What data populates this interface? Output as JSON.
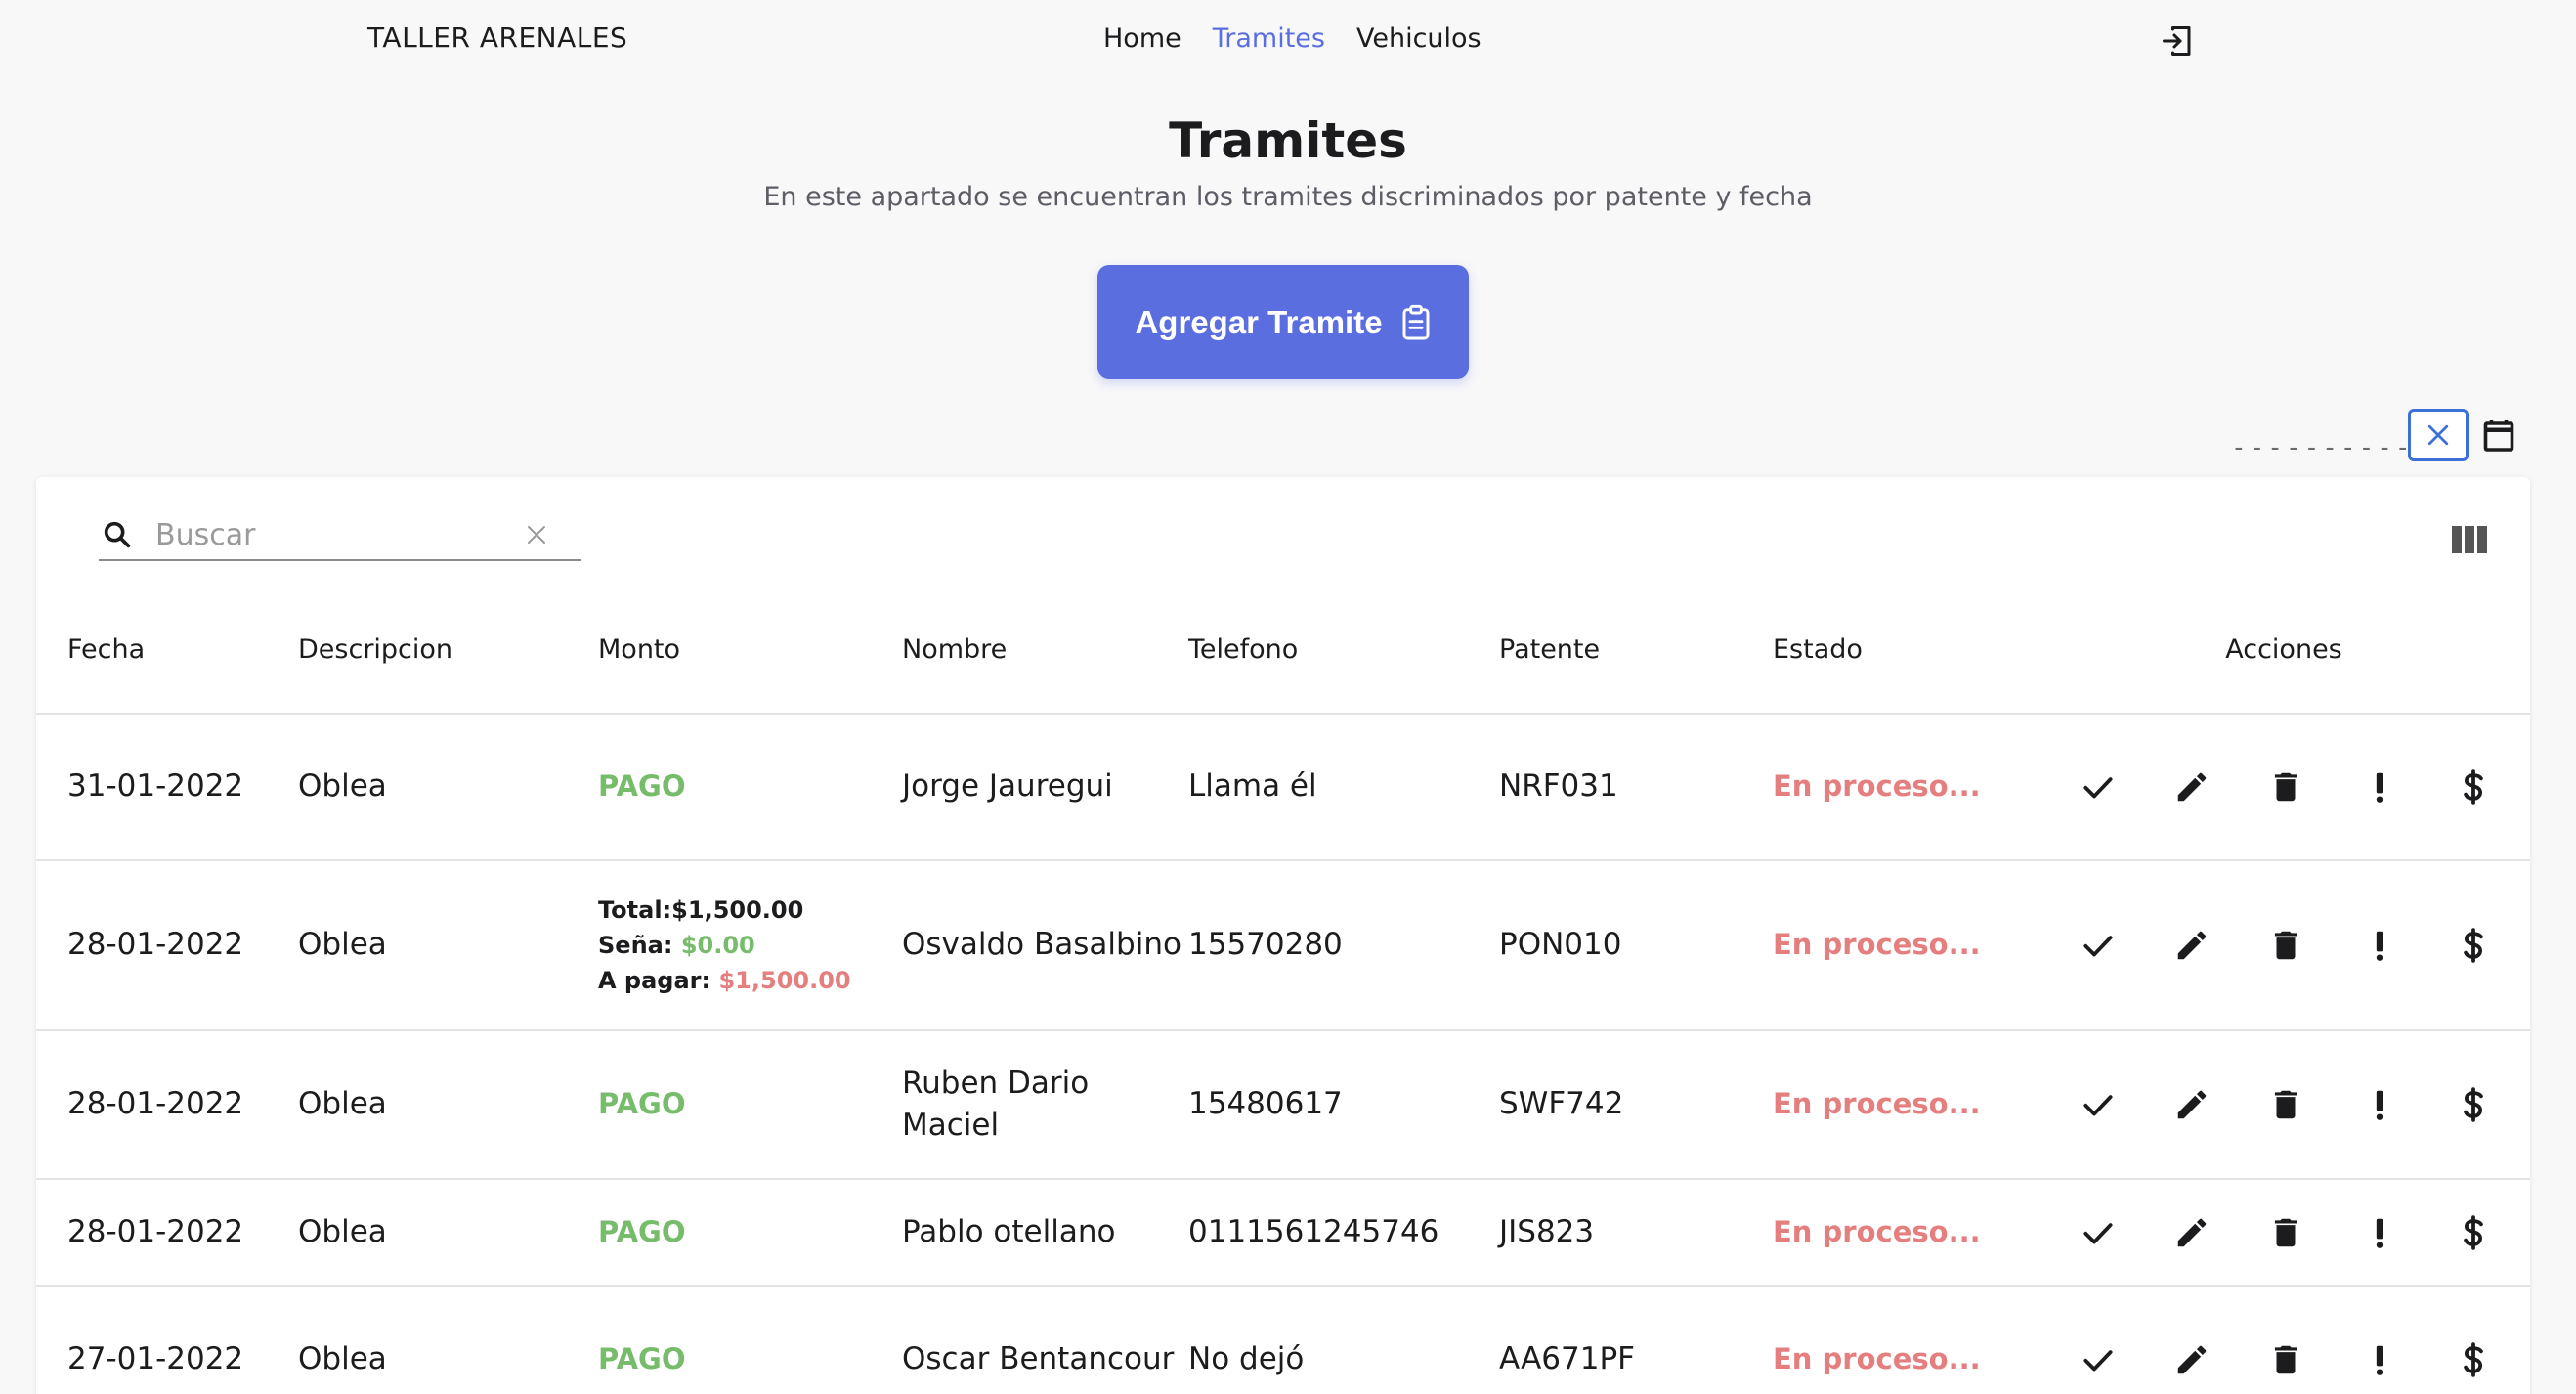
{
  "nav": {
    "brand": "TALLER ARENALES",
    "links": [
      {
        "label": "Home",
        "active": false
      },
      {
        "label": "Tramites",
        "active": true
      },
      {
        "label": "Vehiculos",
        "active": false
      }
    ],
    "logout_icon": "logout-icon"
  },
  "header": {
    "title": "Tramites",
    "subtitle": "En este apartado se encuentran los tramites discriminados por patente y fecha",
    "add_button": "Agregar Tramite"
  },
  "date_filter": {
    "value": "----------"
  },
  "search": {
    "placeholder": "Buscar",
    "value": ""
  },
  "table": {
    "columns": [
      "Fecha",
      "Descripcion",
      "Monto",
      "Nombre",
      "Telefono",
      "Patente",
      "Estado",
      "Acciones"
    ],
    "rows": [
      {
        "fecha": "31-01-2022",
        "descripcion": "Oblea",
        "monto": "PAGO",
        "nombre": "Jorge Jauregui",
        "telefono": "Llama él",
        "patente": "NRF031",
        "estado": "En proceso..."
      },
      {
        "fecha": "28-01-2022",
        "descripcion": "Oblea",
        "monto": {
          "total_label": "Total:",
          "total": "$1,500.00",
          "sena_label": "Seña:",
          "sena": "$0.00",
          "apagar_label": "A pagar:",
          "apagar": "$1,500.00"
        },
        "nombre": "Osvaldo Basalbino",
        "telefono": "15570280",
        "patente": "PON010",
        "estado": "En proceso..."
      },
      {
        "fecha": "28-01-2022",
        "descripcion": "Oblea",
        "monto": "PAGO",
        "nombre": "Ruben Dario Maciel",
        "telefono": "15480617",
        "patente": "SWF742",
        "estado": "En proceso..."
      },
      {
        "fecha": "28-01-2022",
        "descripcion": "Oblea",
        "monto": "PAGO",
        "nombre": "Pablo otellano",
        "telefono": "0111561245746",
        "patente": "JIS823",
        "estado": "En proceso..."
      },
      {
        "fecha": "27-01-2022",
        "descripcion": "Oblea",
        "monto": "PAGO",
        "nombre": "Oscar Bentancour",
        "telefono": "No dejó",
        "patente": "AA671PF",
        "estado": "En proceso..."
      }
    ],
    "actions": [
      "check-icon",
      "edit-pencil-icon",
      "delete-trash-icon",
      "alert-exclamation-icon",
      "dollar-icon"
    ]
  },
  "colors": {
    "accent": "#5b6ee0",
    "pago": "#77bc6b",
    "estado": "#e57e7e",
    "date_clear_border": "#3d6fd8"
  }
}
